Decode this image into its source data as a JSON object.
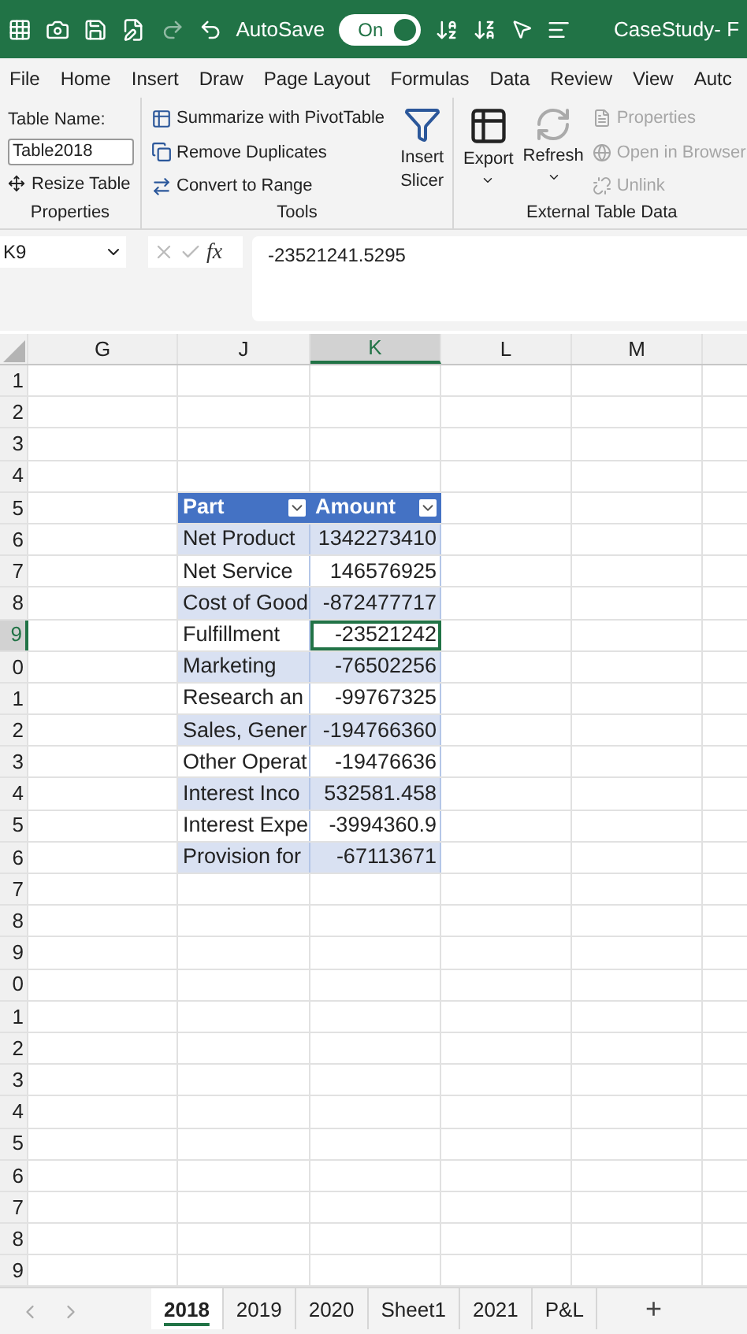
{
  "title_bar": {
    "autosave_label": "AutoSave",
    "autosave": {
      "on": true,
      "label": "On"
    },
    "document_title": "CaseStudy- F"
  },
  "menu_tabs": [
    {
      "label": "File"
    },
    {
      "label": "Home"
    },
    {
      "label": "Insert"
    },
    {
      "label": "Draw"
    },
    {
      "label": "Page Layout"
    },
    {
      "label": "Formulas"
    },
    {
      "label": "Data"
    },
    {
      "label": "Review"
    },
    {
      "label": "View"
    },
    {
      "label": "Autc"
    }
  ],
  "ribbon": {
    "properties_group": {
      "table_name_label": "Table Name:",
      "table_name": "Table2018",
      "resize": "Resize Table",
      "group_label": "Properties"
    },
    "tools_group": {
      "items": [
        {
          "label": "Summarize with PivotTable",
          "kind": "pivot"
        },
        {
          "label": "Remove Duplicates",
          "kind": "dedupe"
        },
        {
          "label": "Convert to Range",
          "kind": "convert"
        }
      ],
      "slicer": "Insert Slicer",
      "group_label": "Tools"
    },
    "external_group": {
      "export": "Export",
      "refresh": "Refresh",
      "items": [
        {
          "label": "Properties",
          "disabled": true,
          "kind": "properties"
        },
        {
          "label": "Open in Browser",
          "disabled": true,
          "kind": "browser"
        },
        {
          "label": "Unlink",
          "disabled": true,
          "kind": "unlink"
        }
      ],
      "group_label": "External Table Data"
    }
  },
  "formula_bar": {
    "name_box": "K9",
    "function_label": "fx",
    "formula": "-23521241.5295"
  },
  "column_headers": [
    {
      "label": "G",
      "selected": false
    },
    {
      "label": "J",
      "selected": false
    },
    {
      "label": "K",
      "selected": true
    },
    {
      "label": "L",
      "selected": false
    },
    {
      "label": "M",
      "selected": false
    }
  ],
  "row_headers": [
    {
      "label": "1",
      "selected": false
    },
    {
      "label": "2",
      "selected": false
    },
    {
      "label": "3",
      "selected": false
    },
    {
      "label": "4",
      "selected": false
    },
    {
      "label": "5",
      "selected": false
    },
    {
      "label": "6",
      "selected": false
    },
    {
      "label": "7",
      "selected": false
    },
    {
      "label": "8",
      "selected": false
    },
    {
      "label": "9",
      "selected": true
    },
    {
      "label": "0",
      "selected": false
    },
    {
      "label": "1",
      "selected": false
    },
    {
      "label": "2",
      "selected": false
    },
    {
      "label": "3",
      "selected": false
    },
    {
      "label": "4",
      "selected": false
    },
    {
      "label": "5",
      "selected": false
    },
    {
      "label": "6",
      "selected": false
    },
    {
      "label": "7",
      "selected": false
    },
    {
      "label": "8",
      "selected": false
    },
    {
      "label": "9",
      "selected": false
    },
    {
      "label": "0",
      "selected": false
    },
    {
      "label": "1",
      "selected": false
    },
    {
      "label": "2",
      "selected": false
    },
    {
      "label": "3",
      "selected": false
    },
    {
      "label": "4",
      "selected": false
    },
    {
      "label": "5",
      "selected": false
    },
    {
      "label": "6",
      "selected": false
    },
    {
      "label": "7",
      "selected": false
    },
    {
      "label": "8",
      "selected": false
    },
    {
      "label": "9",
      "selected": false
    }
  ],
  "table": {
    "columns": [
      "Part",
      "Amount"
    ],
    "rows": [
      {
        "part": "Net Product",
        "amount": "1342273410",
        "selected": false
      },
      {
        "part": "Net Service",
        "amount": "146576925",
        "selected": false
      },
      {
        "part": "Cost of Good",
        "amount": "-872477717",
        "selected": false
      },
      {
        "part": "Fulfillment",
        "amount": "-23521242",
        "selected": true
      },
      {
        "part": "Marketing",
        "amount": "-76502256",
        "selected": false
      },
      {
        "part": "Research an",
        "amount": "-99767325",
        "selected": false
      },
      {
        "part": "Sales, Gener",
        "amount": "-194766360",
        "selected": false
      },
      {
        "part": "Other Operat",
        "amount": "-19476636",
        "selected": false
      },
      {
        "part": "Interest Inco",
        "amount": "532581.458",
        "selected": false
      },
      {
        "part": "Interest Expe",
        "amount": "-3994360.9",
        "selected": false
      },
      {
        "part": "Provision for",
        "amount": "-67113671",
        "selected": false
      }
    ]
  },
  "sheet_tabs": [
    {
      "label": "2018",
      "selected": true
    },
    {
      "label": "2019",
      "selected": false
    },
    {
      "label": "2020",
      "selected": false
    },
    {
      "label": "Sheet1",
      "selected": false
    },
    {
      "label": "2021",
      "selected": false
    },
    {
      "label": "P&L",
      "selected": false
    }
  ],
  "add_sheet": "+"
}
